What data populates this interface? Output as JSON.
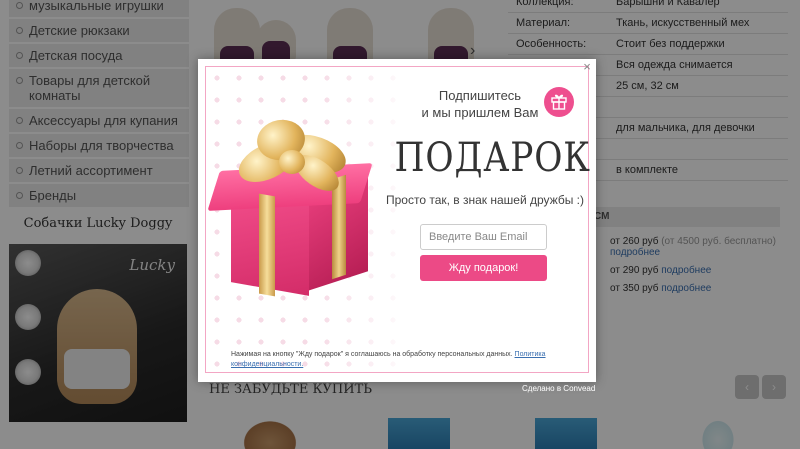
{
  "sidebar": {
    "items": [
      {
        "label": "музыкальные игрушки"
      },
      {
        "label": "Детские рюкзаки"
      },
      {
        "label": "Детская посуда"
      },
      {
        "label": "Товары для детской комнаты"
      },
      {
        "label": "Аксессуары для купания"
      },
      {
        "label": "Наборы для творчества"
      },
      {
        "label": "Летний ассортимент"
      },
      {
        "label": "Бренды"
      }
    ]
  },
  "promo": {
    "title": "Собачки Lucky Doggy",
    "brand": "Lucky"
  },
  "specs": [
    {
      "key": "Коллекция:",
      "value": "Барышни и Кавалер"
    },
    {
      "key": "Материал:",
      "value": "Ткань, искусственный мех"
    },
    {
      "key": "Особенность:",
      "value": "Стоит без поддержки"
    },
    {
      "key": "",
      "value": "Вся одежда снимается"
    },
    {
      "key": "",
      "value": "25 см, 32 см"
    },
    {
      "key": "",
      "value": ""
    },
    {
      "key": "",
      "value": "для мальчика, для девочки"
    },
    {
      "key": "",
      "value": ""
    },
    {
      "key": "",
      "value": "в комплекте"
    }
  ],
  "delivery": {
    "header": "СМ",
    "rows": [
      {
        "price": "от 260 руб",
        "note": " (от 4500 руб. бесплатно)",
        "link": "подробнее"
      },
      {
        "price": "от 290 руб",
        "note": "",
        "link": "подробнее"
      },
      {
        "price": "от 350 руб",
        "note": "",
        "link": "подробнее"
      }
    ]
  },
  "footer": {
    "forget_heading": "НЕ ЗАБУДЬТЕ КУПИТЬ",
    "made_in": "Сделано в Convead",
    "prev_label": "‹",
    "next_label": "›"
  },
  "popup": {
    "close_label": "×",
    "subscribe_line1": "Подпишитесь",
    "subscribe_line2": "и мы пришлем Вам",
    "headline": "ПОДАРОК",
    "subline": "Просто так, в знак нашей дружбы :)",
    "email_placeholder": "Введите Ваш Email",
    "email_value": "",
    "cta_label": "Жду подарок!",
    "legal_text": "Нажимая на кнопку \"Жду подарок\" я соглашаюсь на обработку персональных данных. ",
    "legal_link": "Политика конфиденциальности.",
    "accent_color": "#ec4a86",
    "border_color": "#f3a6c4"
  },
  "icons": {
    "close": "close-icon",
    "gift": "gift-icon"
  }
}
